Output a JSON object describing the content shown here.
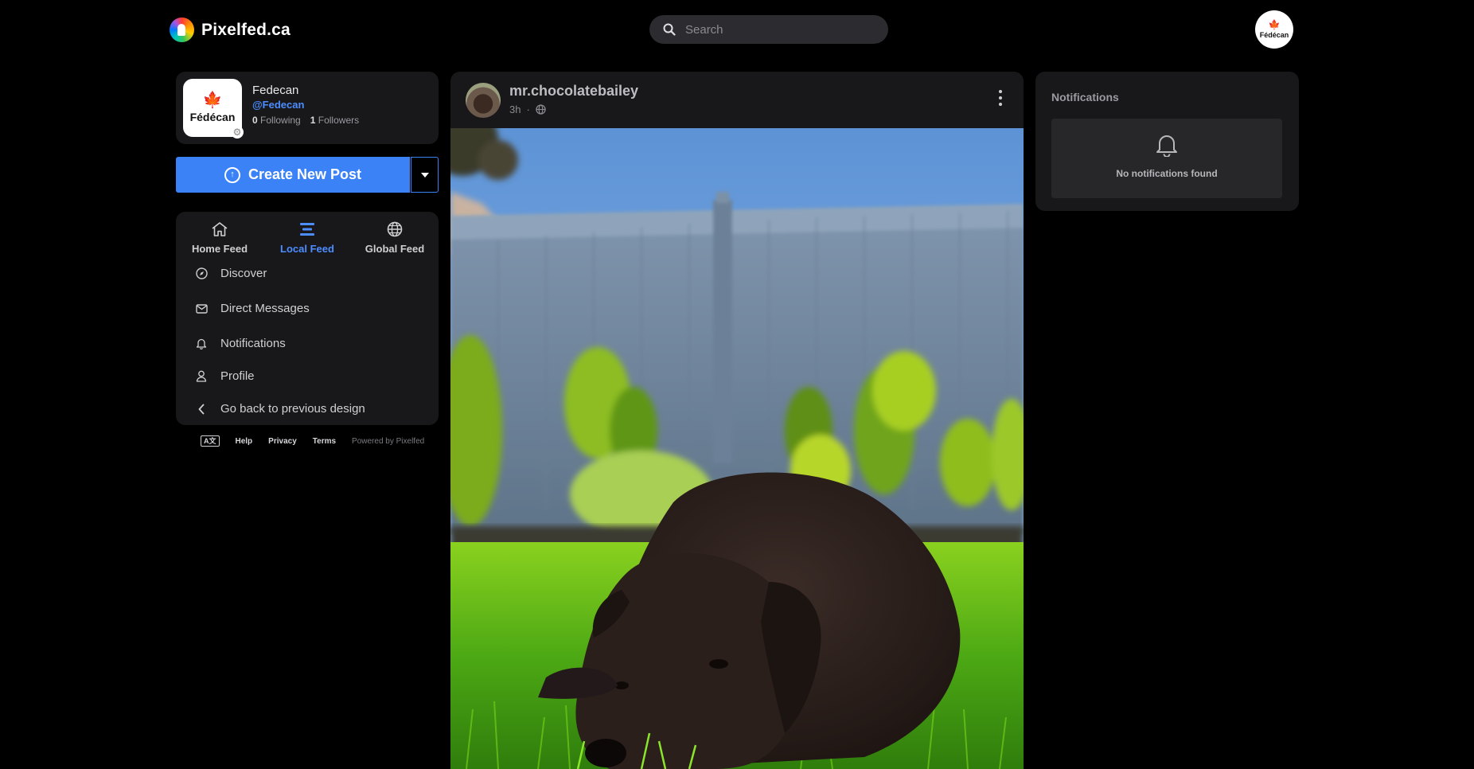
{
  "header": {
    "brand": "Pixelfed.ca",
    "search_placeholder": "Search",
    "avatar_label": "Fédécan"
  },
  "profile": {
    "avatar_label": "Fédécan",
    "name": "Fedecan",
    "handle": "@Fedecan",
    "following_count": "0",
    "following_label": "Following",
    "followers_count": "1",
    "followers_label": "Followers"
  },
  "create_post": {
    "label": "Create New Post"
  },
  "feed_tabs": [
    {
      "label": "Home Feed",
      "icon": "home-icon",
      "active": false
    },
    {
      "label": "Local Feed",
      "icon": "list-icon",
      "active": true
    },
    {
      "label": "Global Feed",
      "icon": "globe-icon",
      "active": false
    }
  ],
  "menu": [
    {
      "label": "Discover",
      "icon": "compass-icon"
    },
    {
      "label": "Direct Messages",
      "icon": "envelope-icon"
    },
    {
      "label": "Notifications",
      "icon": "bell-icon"
    },
    {
      "label": "Profile",
      "icon": "user-icon"
    },
    {
      "label": "Go back to previous design",
      "icon": "chevron-left-icon"
    }
  ],
  "footer": {
    "lang": "A文",
    "help": "Help",
    "privacy": "Privacy",
    "terms": "Terms",
    "powered": "Powered by Pixelfed"
  },
  "post": {
    "username": "mr.chocolatebailey",
    "time": "3h",
    "separator": "·",
    "visibility_icon": "globe-icon"
  },
  "notifications": {
    "title": "Notifications",
    "empty_text": "No notifications found"
  },
  "colors": {
    "accent": "#3b82f6",
    "card": "#18181b",
    "background": "#000000"
  }
}
